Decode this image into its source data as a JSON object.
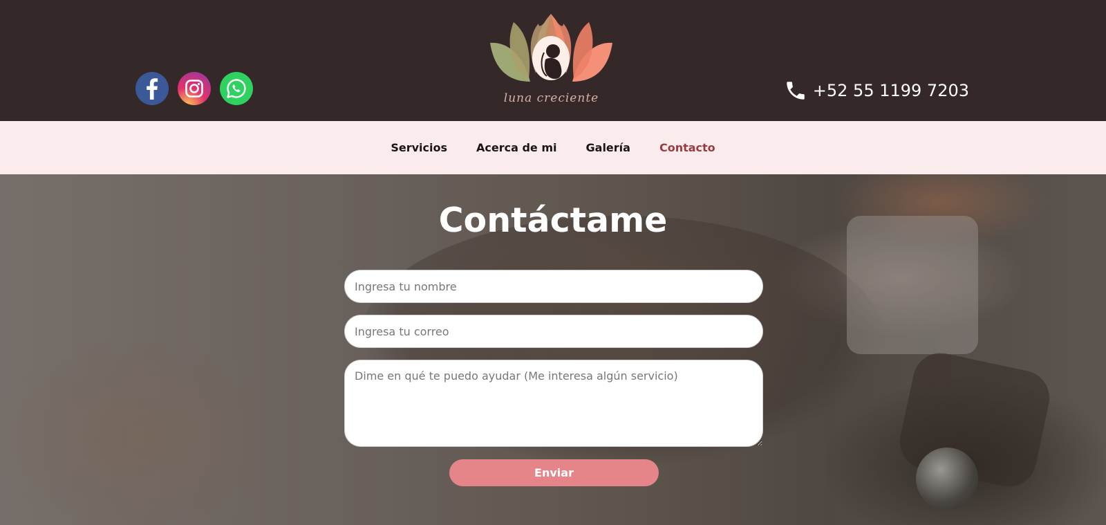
{
  "header": {
    "social": [
      {
        "name": "facebook-icon",
        "color": "#3b5998"
      },
      {
        "name": "instagram-icon",
        "color": "#c13584"
      },
      {
        "name": "whatsapp-icon",
        "color": "#2fd161"
      }
    ],
    "logo_text": "luna creciente",
    "phone": "+52 55 1199 7203"
  },
  "nav": {
    "items": [
      {
        "label": "Servicios",
        "active": false
      },
      {
        "label": "Acerca de mi",
        "active": false
      },
      {
        "label": "Galería",
        "active": false
      },
      {
        "label": "Contacto",
        "active": true
      }
    ],
    "active_color": "#9b3a43"
  },
  "contact": {
    "title": "Contáctame",
    "name_placeholder": "Ingresa tu nombre",
    "email_placeholder": "Ingresa tu correo",
    "message_placeholder": "Dime en qué te puedo ayudar (Me interesa algún servicio)",
    "submit_label": "Enviar",
    "button_color": "#e5858a"
  },
  "colors": {
    "header_bg": "#342829",
    "nav_bg": "#faecec"
  }
}
